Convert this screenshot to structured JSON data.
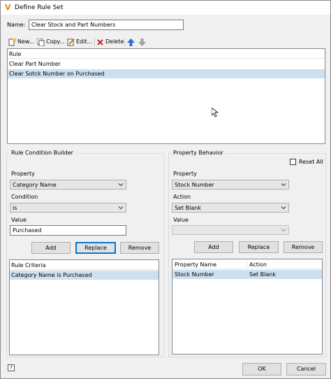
{
  "window": {
    "title": "Define Rule Set"
  },
  "name": {
    "label": "Name:",
    "value": "Clear Stock and Part Numbers"
  },
  "toolbar": {
    "new_label": "New...",
    "copy_label": "Copy...",
    "edit_label": "Edit...",
    "delete_label": "Delete"
  },
  "rules": {
    "header": "Rule",
    "items": [
      "Clear Part Number",
      "Clear Sotck Number on Purchased"
    ]
  },
  "condition_builder": {
    "title": "Rule Condition Builder",
    "property_label": "Property",
    "property_value": "Category Name",
    "condition_label": "Condition",
    "condition_value": "is",
    "value_label": "Value",
    "value_value": "Purchased",
    "add_label": "Add",
    "replace_label": "Replace",
    "remove_label": "Remove",
    "criteria_header": "Rule Criteria",
    "criteria_items": [
      "Category Name is Purchased"
    ]
  },
  "property_behavior": {
    "title": "Property Behavior",
    "reset_all_label": "Reset All",
    "property_label": "Property",
    "property_value": "Stock Number",
    "action_label": "Action",
    "action_value": "Set Blank",
    "value_label": "Value",
    "value_value": "",
    "add_label": "Add",
    "replace_label": "Replace",
    "remove_label": "Remove",
    "col_property_name": "Property Name",
    "col_action": "Action",
    "rows": [
      {
        "property": "Stock Number",
        "action": "Set Blank"
      }
    ]
  },
  "footer": {
    "help_label": "?",
    "ok_label": "OK",
    "cancel_label": "Cancel"
  },
  "colors": {
    "selection": "#cce0f0",
    "focus": "#0078d7",
    "logo": "#e0841a"
  }
}
